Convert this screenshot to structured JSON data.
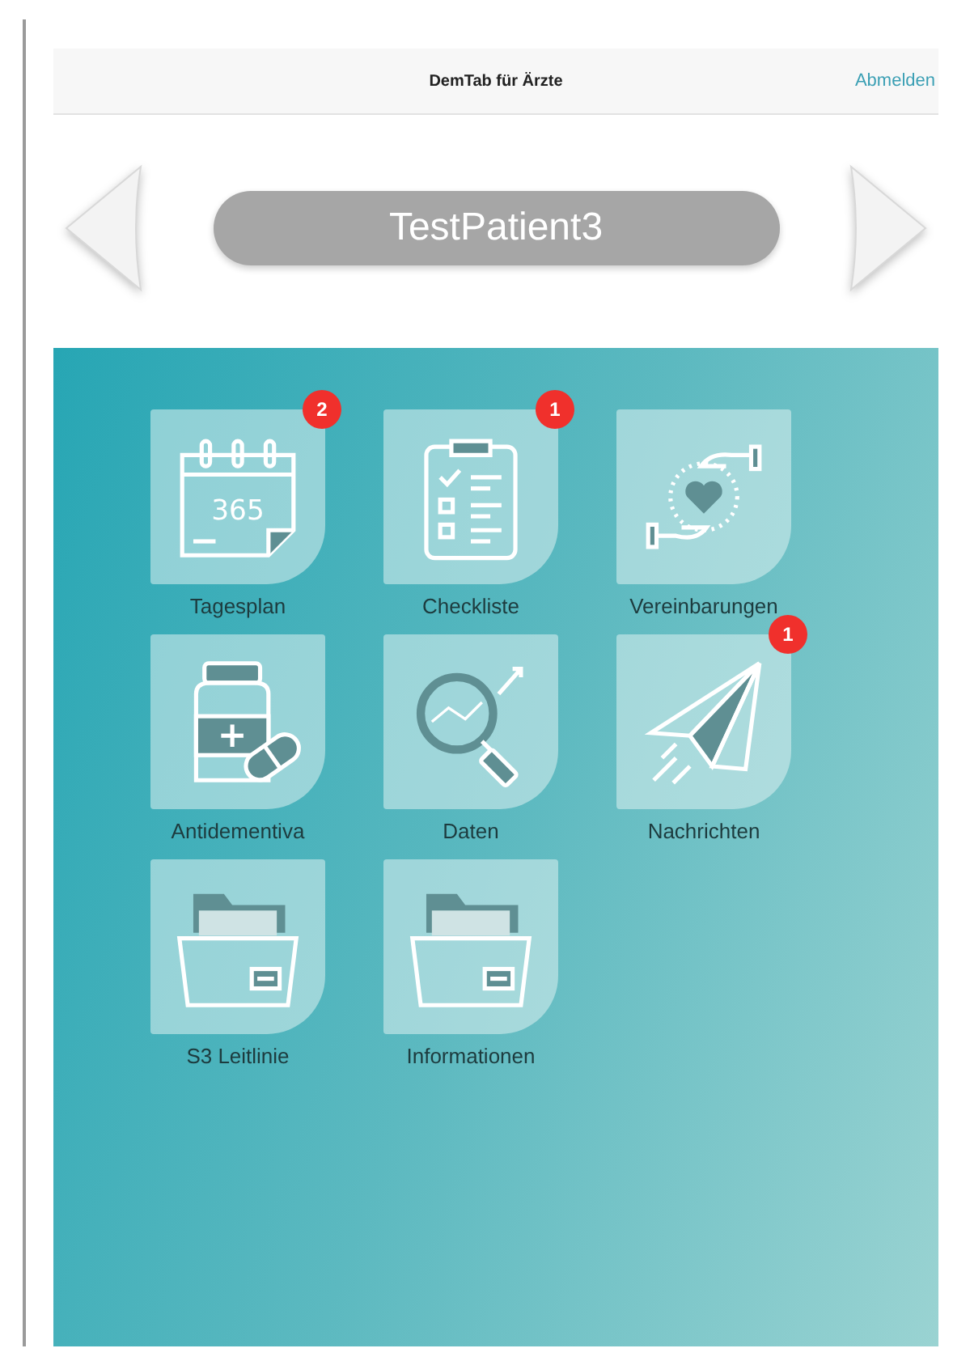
{
  "nav_bar": {
    "title": "DemTab für Ärzte",
    "action": "Abmelden"
  },
  "patient": {
    "name": "TestPatient3"
  },
  "tiles": [
    {
      "label": "Tagesplan",
      "kind": "calendar",
      "icon_text": "365",
      "badge": "2"
    },
    {
      "label": "Checkliste",
      "kind": "clipboard",
      "badge": "1"
    },
    {
      "label": "Vereinbarungen",
      "kind": "hands"
    },
    {
      "label": "Antidementiva",
      "kind": "medicine"
    },
    {
      "label": "Daten",
      "kind": "magnifier"
    },
    {
      "label": "Nachrichten",
      "kind": "plane",
      "badge": "1"
    },
    {
      "label": "S3 Leitlinie",
      "kind": "folder"
    },
    {
      "label": "Informationen",
      "kind": "folder"
    }
  ]
}
